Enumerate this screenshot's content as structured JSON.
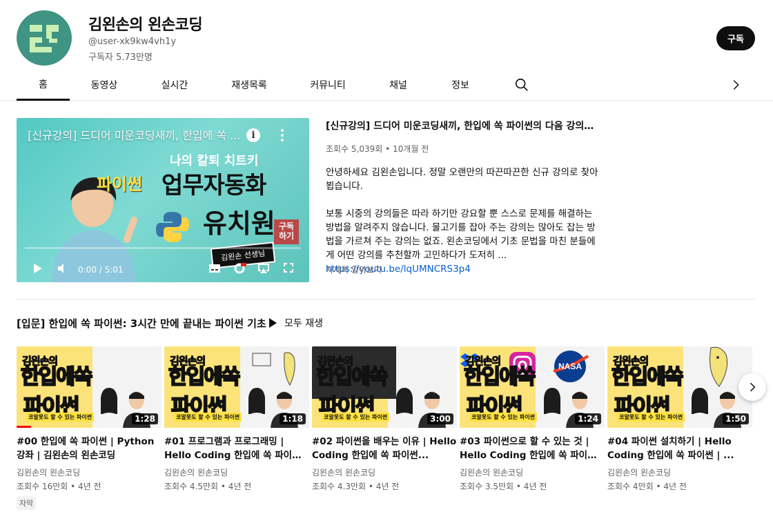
{
  "channel": {
    "name": "김왼손의 왼손코딩",
    "handle": "@user-xk9kw4vh1y",
    "subscribers": "구독자 5.73만명",
    "subscribe_label": "구독",
    "avatar_color": "#3f9483"
  },
  "tabs": [
    {
      "label": "홈",
      "active": true
    },
    {
      "label": "동영상"
    },
    {
      "label": "실시간"
    },
    {
      "label": "재생목록"
    },
    {
      "label": "커뮤니티"
    },
    {
      "label": "채널"
    },
    {
      "label": "정보"
    }
  ],
  "featured": {
    "overlay_title": "[신규강의] 드디어 미운코딩새끼, 한입에 쏙 ...",
    "thumb_tag": "나의 칼퇴 치트키",
    "thumb_python": "파이썬",
    "thumb_line1": "업무자동화",
    "thumb_line2": "유치원",
    "thumb_stamp": "김왼손 선생님",
    "thumb_subbox": "구독\n하기",
    "time": "0:00 / 5:01",
    "title": "[신규강의] 드디어 미운코딩새끼, 한입에 쏙 파이썬의 다음 강의가 완성되...",
    "meta": "조회수 5,039회 • 10개월 전",
    "desc_p1": "안녕하세요 김왼손입니다. 정말 오랜만의 따끈따끈한 신규 강의로 찾아뵙습니다.",
    "desc_p2": "보통 시중의 강의들은 따라 하기만 강요할 뿐 스스로 문제를 해결하는 방법을 알려주지 않습니다. 물고기를 잡아 주는 강의는 많아도 잡는 방법을 가르쳐 주는 강의는 없죠. 왼손코딩에서 기초 문법을 마친 분들에게 어떤 강의를 추천할까 고민하다가 도저히 ...",
    "desc_link": "https://youtu.be/lqUMNCRS3p4",
    "more_label": "자세히 알아보기"
  },
  "shelf": {
    "title": "[입문] 한입에 쏙 파이썬: 3시간 만에 끝내는 파이썬 기초",
    "play_all": "모두 재생"
  },
  "videos": [
    {
      "t1": "김왼손의",
      "t2": "한입에쏙",
      "t3": "파이썬",
      "t4": "코알못도 할 수 있는 파이썬",
      "duration": "1:28",
      "title": "#00 한입에 쏙 파이썬 | Python 강좌 | 김왼손의 왼손코딩",
      "channel": "김왼손의 왼손코딩",
      "meta": "조회수 16만회 • 4년 전",
      "badge": "자막",
      "watched": 0.1
    },
    {
      "t1": "김왼손의",
      "t2": "한입에쏙",
      "t3": "파이썬",
      "t4": "코알못도 할 수 있는 파이썬",
      "duration": "1:18",
      "title": "#01 프로그램과 프로그래밍 | Hello Coding 한입에 쏙 파이썬...",
      "channel": "김왼손의 왼손코딩",
      "meta": "조회수 4.5만회 • 4년 전"
    },
    {
      "t1": "김왼손의",
      "t2": "한입에쏙",
      "t3": "파이썬",
      "t4": "코알못도 할 수 있는 파이썬",
      "duration": "3:00",
      "title": "#02 파이썬을 배우는 이유 | Hello Coding 한입에 쏙 파이썬...",
      "channel": "김왼손의 왼손코딩",
      "meta": "조회수 4.3만회 • 4년 전"
    },
    {
      "t1": "김왼손의",
      "t2": "한입에쏙",
      "t3": "파이썬",
      "t4": "코알못도 할 수 있는 파이썬",
      "duration": "1:24",
      "title": "#03 파이썬으로 할 수 있는 것 | Hello Coding 한입에 쏙 파이썬...",
      "channel": "김왼손의 왼손코딩",
      "meta": "조회수 3.5만회 • 4년 전",
      "logo_text": "NASA"
    },
    {
      "t1": "김왼손의",
      "t2": "한입에쏙",
      "t3": "파이썬",
      "t4": "코알못도 할 수 있는 파이썬",
      "duration": "1:50",
      "title": "#04 파이썬 설치하기 | Hello Coding 한입에 쏙 파이썬 | ...",
      "channel": "김왼손의 왼손코딩",
      "meta": "조회수 4만회 • 4년 전"
    }
  ],
  "icons": {
    "search": "search-icon",
    "tabs_next": "chevron-right-icon",
    "shelf_next": "chevron-right-icon",
    "play_all": "play-icon"
  }
}
